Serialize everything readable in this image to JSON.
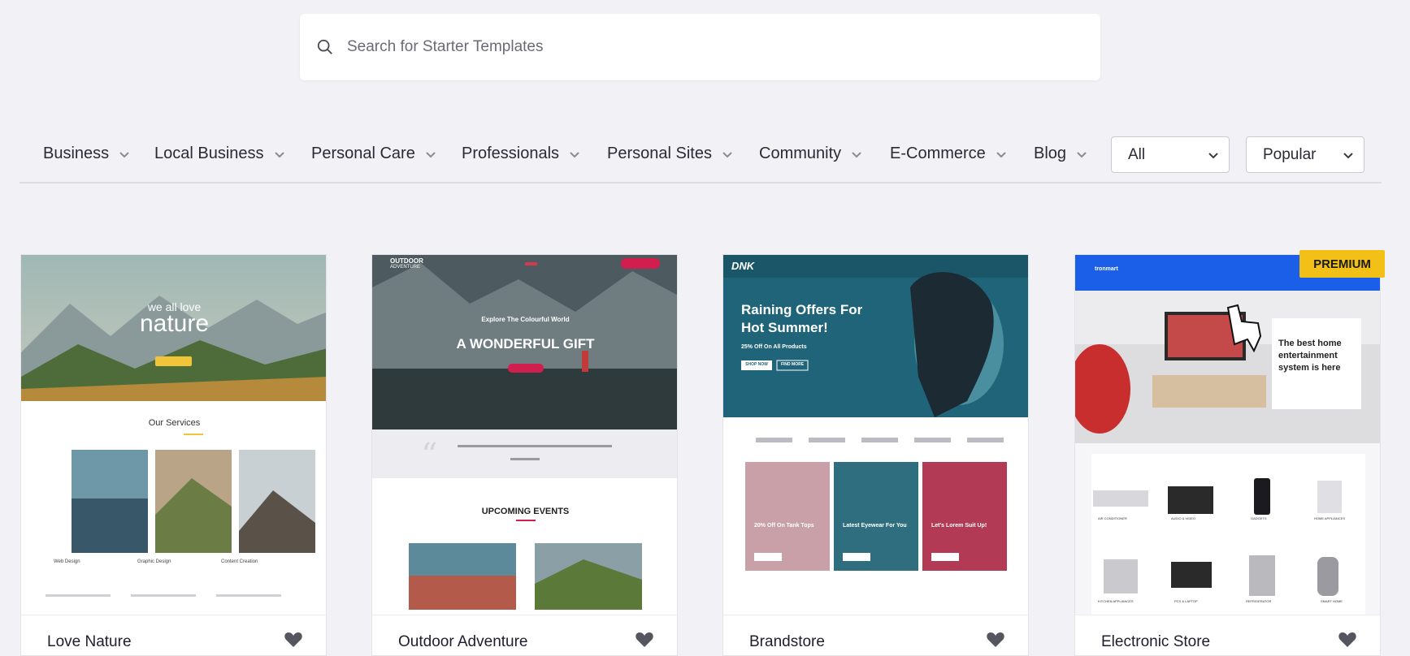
{
  "search": {
    "placeholder": "Search for Starter Templates"
  },
  "filters": {
    "categories": [
      "Business",
      "Local Business",
      "Personal Care",
      "Professionals",
      "Personal Sites",
      "Community",
      "E-Commerce",
      "Blog"
    ],
    "type_select": "All",
    "sort_select": "Popular"
  },
  "cards": [
    {
      "name": "Love Nature",
      "preview": {
        "hero_small": "we all love",
        "hero_big": "nature",
        "section_title": "Our Services",
        "services": [
          "Web Design",
          "Graphic Design",
          "Content Creation"
        ]
      }
    },
    {
      "name": "Outdoor Adventure",
      "preview": {
        "logo": "OUTDOOR",
        "logo_sub": "ADVENTURE",
        "kicker": "Explore The Colourful World",
        "headline": "A WONDERFUL GIFT",
        "events_title": "UPCOMING EVENTS"
      }
    },
    {
      "name": "Brandstore",
      "preview": {
        "logo": "DNK",
        "headline_1": "Raining Offers For",
        "headline_2": "Hot Summer!",
        "sub": "25% Off On All Products",
        "btn_1": "SHOP NOW",
        "btn_2": "FIND MORE",
        "tiles": [
          "20% Off On Tank Tops",
          "Latest Eyewear For You",
          "Let's Lorem Suit Up!"
        ]
      }
    },
    {
      "name": "Electronic Store",
      "badge": "PREMIUM",
      "preview": {
        "logo": "tronmart",
        "headline_1": "The best home",
        "headline_2": "entertainment",
        "headline_3": "system is here",
        "products": [
          "AIR CONDITIONER",
          "AUDIO & VIDEO",
          "GADGETS",
          "HOME APPLIANCES",
          "KITCHEN APPLIANCES",
          "PCS & LAPTOP",
          "REFRIGERATOR",
          "SMART HOME"
        ]
      }
    }
  ],
  "colors": {
    "accent": "#f3c018",
    "bg": "#f2f2f6",
    "heart": "#555560"
  }
}
